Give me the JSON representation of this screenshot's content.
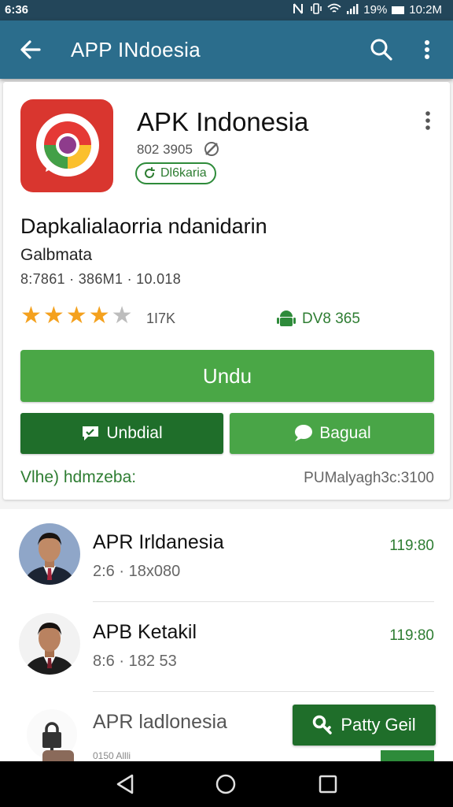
{
  "status_bar": {
    "left_text": "6:36",
    "battery": "19%",
    "time": "10:2M",
    "icons": [
      "nfc-icon",
      "vibrate-icon",
      "wifi-icon",
      "signal-icon",
      "battery-icon"
    ]
  },
  "app_bar": {
    "title": "APP INdoesia",
    "icons": [
      "back-arrow-icon",
      "search-icon",
      "more-vert-icon"
    ]
  },
  "app_card": {
    "icon": "chrome-icon",
    "accent": "#d9362f",
    "title": "APK Indonesia",
    "subtitle": "802 3905",
    "badge": "Dl6karia",
    "heading": "Dapkalialaorria ndanidarin",
    "category": "Galbmata",
    "meta": "8:7861 · 386M1 · 10.018",
    "rating": {
      "stars": 4,
      "max": 5,
      "count": "1I7K"
    },
    "version": "DV8 365",
    "primary_button": "Undu",
    "secondary_buttons": [
      {
        "label": "Unbdial",
        "icon": "chat-icon"
      },
      {
        "label": "Bagual",
        "icon": "comment-icon"
      }
    ],
    "footer_left": "Vlhe) hdmzeba:",
    "footer_right": "PUMalyagh3c:3100",
    "colors": {
      "green": "#4aa746",
      "dark_green": "#1f6e2a",
      "text_green": "#2e7d32"
    }
  },
  "list": {
    "items": [
      {
        "name": "APR Irldanesia",
        "detail": "2:6 · 18x080",
        "time": "119:80"
      },
      {
        "name": "APB Ketakil",
        "detail": "8:6 · 182 53",
        "time": "119:80"
      },
      {
        "name": "APR ladlonesia",
        "detail": "",
        "time": ""
      }
    ],
    "action_button": "Patty Geil",
    "peek_text": "0150 Allli"
  },
  "nav_bar": {
    "icons": [
      "nav-back-icon",
      "nav-home-icon",
      "nav-recents-icon"
    ]
  }
}
